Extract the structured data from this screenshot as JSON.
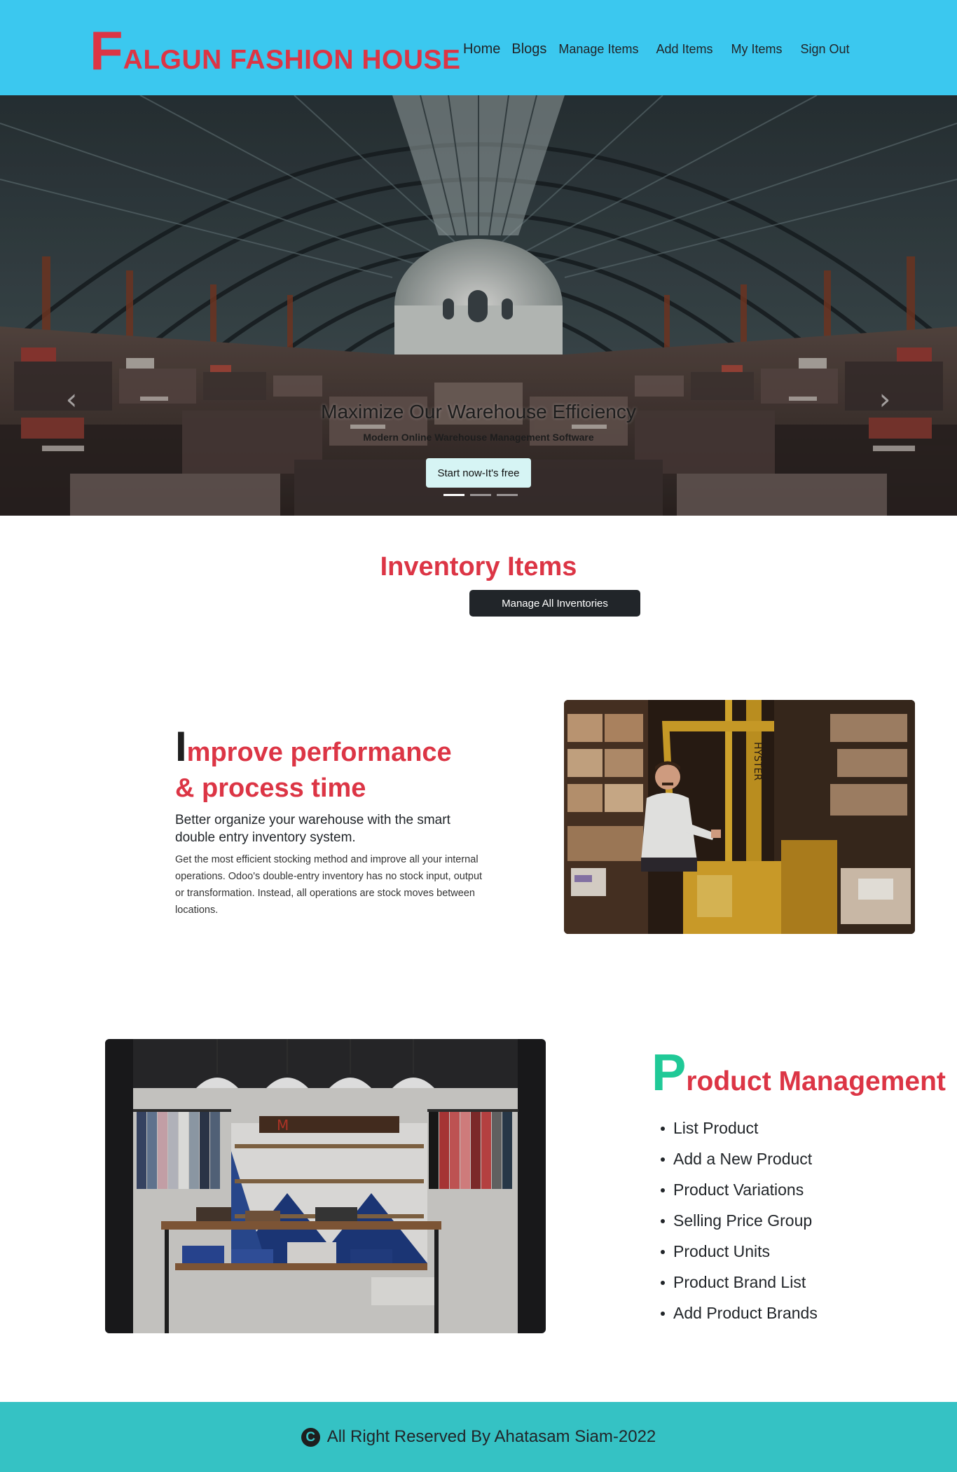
{
  "navbar": {
    "brand_initial": "F",
    "brand_rest": "ALGUN FASHION HOUSE",
    "links": [
      {
        "label": "Home"
      },
      {
        "label": "Blogs"
      },
      {
        "label": "Manage Items"
      },
      {
        "label": "Add Items"
      },
      {
        "label": "My Items"
      },
      {
        "label": "Sign Out"
      }
    ]
  },
  "hero": {
    "title": "Maximize Our Warehouse Efficiency",
    "subtitle": "Modern Online Warehouse Management Software",
    "cta": "Start now-It's free",
    "prev_icon": "chevron-left-icon",
    "next_icon": "chevron-right-icon",
    "slides": 3,
    "active_slide": 1
  },
  "inventory": {
    "title": "Inventory Items",
    "button": "Manage All Inventories"
  },
  "improve": {
    "title_initial": "I",
    "title_line1": "mprove performance",
    "title_line2": "& process time",
    "subtitle": "Better organize your warehouse with the smart double entry inventory system.",
    "body": "Get the most efficient stocking method and improve all your internal operations. Odoo's double-entry inventory has no stock input, output or transformation. Instead, all operations are stock moves between locations."
  },
  "product": {
    "title_initial": "P",
    "title_rest": "roduct Management",
    "items": [
      "List Product",
      "Add a New Product",
      "Product Variations",
      "Selling Price Group",
      "Product Units",
      "Product Brand List",
      "Add Product Brands"
    ]
  },
  "footer": {
    "icon": "copyright-icon",
    "icon_glyph": "C",
    "text": "All Right Reserved By Ahatasam Siam-2022"
  },
  "colors": {
    "navbar_bg": "#3bc8ef",
    "brand": "#dc3545",
    "accent_red": "#dc3545",
    "accent_green": "#20c997",
    "footer_bg": "#35c2c4",
    "dark_button": "#212529"
  }
}
